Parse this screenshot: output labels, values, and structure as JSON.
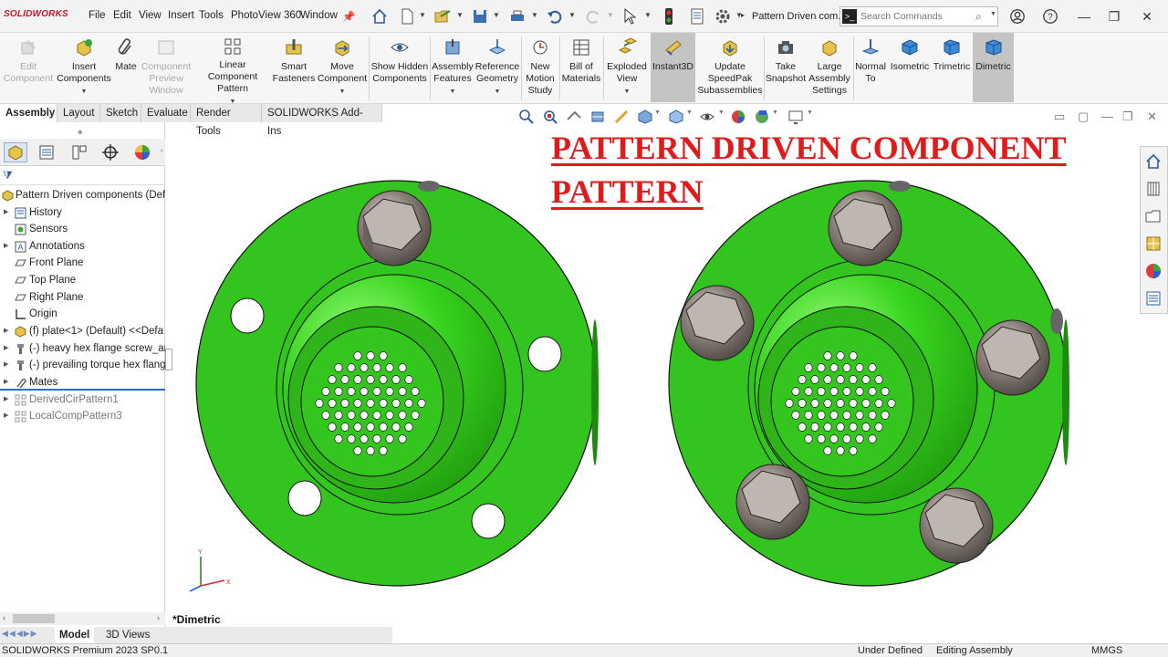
{
  "app": {
    "logo": "SOLIDWORKS",
    "menu": [
      "File",
      "Edit",
      "View",
      "Insert",
      "Tools",
      "PhotoView 360",
      "Window"
    ],
    "document_title": "Pattern Driven com...",
    "search": {
      "placeholder": "Search Commands"
    }
  },
  "ribbon": {
    "commands": [
      {
        "label": "Edit Component",
        "disabled": true
      },
      {
        "label": "Insert Components"
      },
      {
        "label": "Mate"
      },
      {
        "label": "Component Preview Window",
        "disabled": true
      },
      {
        "label": "Linear Component Pattern"
      },
      {
        "label": "Smart Fasteners"
      },
      {
        "label": "Move Component"
      },
      {
        "label": "Show Hidden Components"
      },
      {
        "label": "Assembly Features"
      },
      {
        "label": "Reference Geometry"
      },
      {
        "label": "New Motion Study"
      },
      {
        "label": "Bill of Materials"
      },
      {
        "label": "Exploded View"
      },
      {
        "label": "Instant3D",
        "active": true
      },
      {
        "label": "Update SpeedPak Subassemblies"
      },
      {
        "label": "Take Snapshot"
      },
      {
        "label": "Large Assembly Settings"
      },
      {
        "label": "Normal To"
      },
      {
        "label": "Isometric"
      },
      {
        "label": "Trimetric"
      },
      {
        "label": "Dimetric",
        "active": true
      }
    ]
  },
  "tabs": [
    "Assembly",
    "Layout",
    "Sketch",
    "Evaluate",
    "Render Tools",
    "SOLIDWORKS Add-Ins"
  ],
  "feature_tree": {
    "root": "Pattern Driven components  (Def",
    "items": [
      {
        "label": "History"
      },
      {
        "label": "Sensors"
      },
      {
        "label": "Annotations"
      },
      {
        "label": "Front Plane"
      },
      {
        "label": "Top Plane"
      },
      {
        "label": "Right Plane"
      },
      {
        "label": "Origin"
      },
      {
        "label": "(f) plate<1> (Default) <<Defa"
      },
      {
        "label": "(-) heavy hex flange screw_an"
      },
      {
        "label": "(-) prevailing torque hex flang"
      },
      {
        "label": "Mates"
      },
      {
        "label": "DerivedCirPattern1"
      },
      {
        "label": "LocalCompPattern3"
      }
    ]
  },
  "graphics": {
    "heading_line1": "PATTERN DRIVEN COMPONENT",
    "heading_line2": "PATTERN",
    "view_label": "*Dimetric",
    "triad": {
      "x": "X",
      "y": "Y"
    }
  },
  "bottom_tabs": [
    "Model",
    "3D Views"
  ],
  "status": {
    "version": "SOLIDWORKS Premium 2023 SP0.1",
    "state": "Under Defined",
    "mode": "Editing Assembly",
    "units": "MMGS"
  },
  "colors": {
    "part_green": "#33c41f",
    "heading_red": "#e11b1b",
    "accent_blue": "#2a6fc7"
  }
}
